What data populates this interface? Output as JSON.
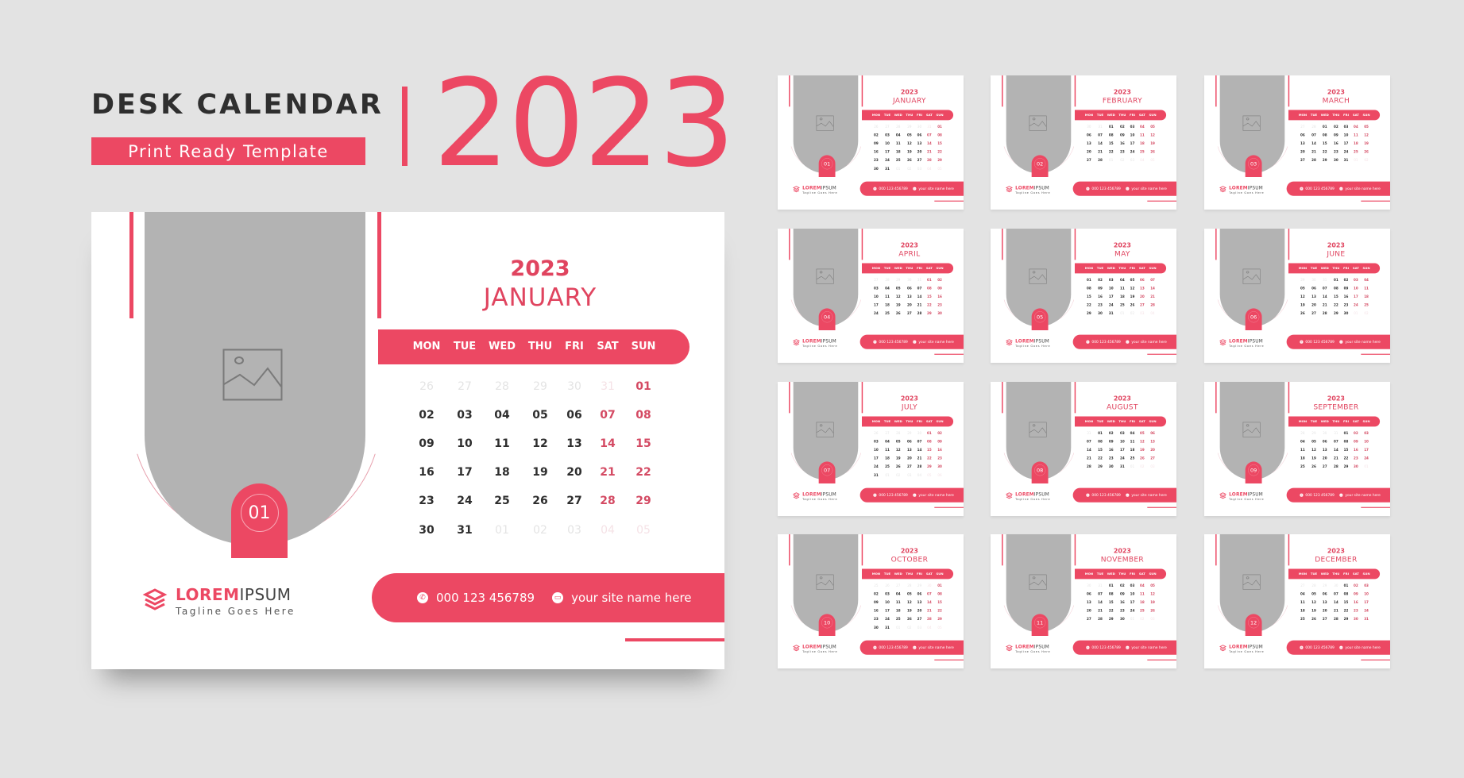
{
  "header": {
    "title": "DESK CALENDAR",
    "subtitle": "Print Ready Template",
    "year": "2023"
  },
  "colors": {
    "accent": "#ec4863",
    "photo_placeholder": "#b3b3b3",
    "background": "#e3e3e3"
  },
  "weekdays": [
    "MON",
    "TUE",
    "WED",
    "THU",
    "FRI",
    "SAT",
    "SUN"
  ],
  "brand": {
    "name_bold": "LOREM",
    "name_light": "IPSUM",
    "tagline": "Tagline Goes Here",
    "icon": "stacked-layers-icon"
  },
  "contact": {
    "phone": "000 123 456789",
    "phone_icon": "phone-icon",
    "site": "your site name here",
    "site_icon": "web-icon"
  },
  "main": {
    "year": "2023",
    "month": "JANUARY",
    "number": "01",
    "grid": [
      [
        [
          "26",
          "out"
        ],
        [
          "27",
          "out"
        ],
        [
          "28",
          "out"
        ],
        [
          "29",
          "out"
        ],
        [
          "30",
          "out"
        ],
        [
          "31",
          "outwe"
        ],
        [
          "01",
          "we"
        ]
      ],
      [
        [
          "02",
          ""
        ],
        [
          "03",
          ""
        ],
        [
          "04",
          ""
        ],
        [
          "05",
          ""
        ],
        [
          "06",
          ""
        ],
        [
          "07",
          "we"
        ],
        [
          "08",
          "we"
        ]
      ],
      [
        [
          "09",
          ""
        ],
        [
          "10",
          ""
        ],
        [
          "11",
          ""
        ],
        [
          "12",
          ""
        ],
        [
          "13",
          ""
        ],
        [
          "14",
          "we"
        ],
        [
          "15",
          "we"
        ]
      ],
      [
        [
          "16",
          ""
        ],
        [
          "17",
          ""
        ],
        [
          "18",
          ""
        ],
        [
          "19",
          ""
        ],
        [
          "20",
          ""
        ],
        [
          "21",
          "we"
        ],
        [
          "22",
          "we"
        ]
      ],
      [
        [
          "23",
          ""
        ],
        [
          "24",
          ""
        ],
        [
          "25",
          ""
        ],
        [
          "26",
          ""
        ],
        [
          "27",
          ""
        ],
        [
          "28",
          "we"
        ],
        [
          "29",
          "we"
        ]
      ],
      [
        [
          "30",
          ""
        ],
        [
          "31",
          ""
        ],
        [
          "01",
          "out"
        ],
        [
          "02",
          "out"
        ],
        [
          "03",
          "out"
        ],
        [
          "04",
          "outwe"
        ],
        [
          "05",
          "outwe"
        ]
      ]
    ]
  },
  "months": [
    {
      "name": "JANUARY",
      "number": "01"
    },
    {
      "name": "FEBRUARY",
      "number": "02"
    },
    {
      "name": "MARCH",
      "number": "03"
    },
    {
      "name": "APRIL",
      "number": "04"
    },
    {
      "name": "MAY",
      "number": "05"
    },
    {
      "name": "JUNE",
      "number": "06"
    },
    {
      "name": "JULY",
      "number": "07"
    },
    {
      "name": "AUGUST",
      "number": "08"
    },
    {
      "name": "SEPTEMBER",
      "number": "09"
    },
    {
      "name": "OCTOBER",
      "number": "10"
    },
    {
      "name": "NOVEMBER",
      "number": "11"
    },
    {
      "name": "DECEMBER",
      "number": "12"
    }
  ]
}
